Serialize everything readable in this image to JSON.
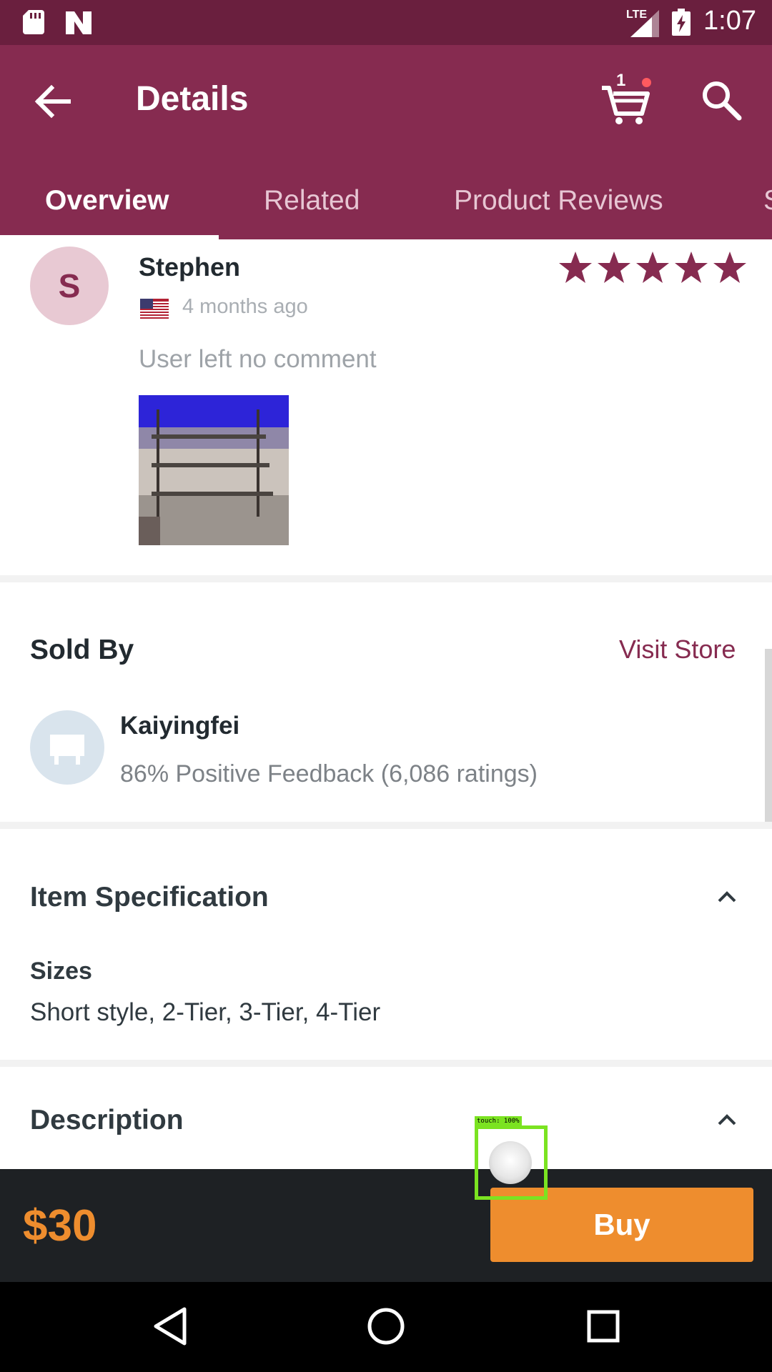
{
  "status_bar": {
    "network": "LTE",
    "time": "1:07"
  },
  "app_bar": {
    "title": "Details",
    "cart_count": "1",
    "tabs": [
      {
        "label": "Overview"
      },
      {
        "label": "Related"
      },
      {
        "label": "Product Reviews"
      },
      {
        "label": "S"
      }
    ]
  },
  "review": {
    "avatar_letter": "S",
    "reviewer": "Stephen",
    "time_ago": "4 months ago",
    "comment": "User left no comment",
    "rating": 5
  },
  "sold_by": {
    "title": "Sold By",
    "visit_store": "Visit Store",
    "store_name": "Kaiyingfei",
    "feedback": "86% Positive Feedback (6,086 ratings)"
  },
  "item_spec": {
    "title": "Item Specification",
    "sizes_label": "Sizes",
    "sizes_value": "Short style, 2-Tier, 3-Tier, 4-Tier"
  },
  "description": {
    "title": "Description"
  },
  "touch_overlay": {
    "label": "touch: 100%"
  },
  "buy_bar": {
    "price": "$30",
    "buy_label": "Buy"
  },
  "colors": {
    "status_bar": "#6a1f3e",
    "app_bar": "#862b50",
    "accent_orange": "#ee8d2e",
    "buy_bar_bg": "#1e2124"
  }
}
